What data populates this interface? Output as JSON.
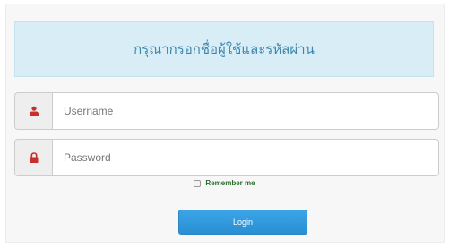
{
  "alert": {
    "message": "กรุณากรอกชื่อผู้ใช้และรหัสผ่าน"
  },
  "username": {
    "icon": "user-icon",
    "placeholder": "Username",
    "value": ""
  },
  "password": {
    "icon": "lock-icon",
    "placeholder": "Password",
    "value": ""
  },
  "remember": {
    "label": "Remember me",
    "checked": false
  },
  "login": {
    "label": "Login"
  },
  "colors": {
    "alert_bg": "#d9edf7",
    "icon": "#c9302c",
    "button": "#2a8ed3",
    "remember_text": "#2b6b2b"
  }
}
